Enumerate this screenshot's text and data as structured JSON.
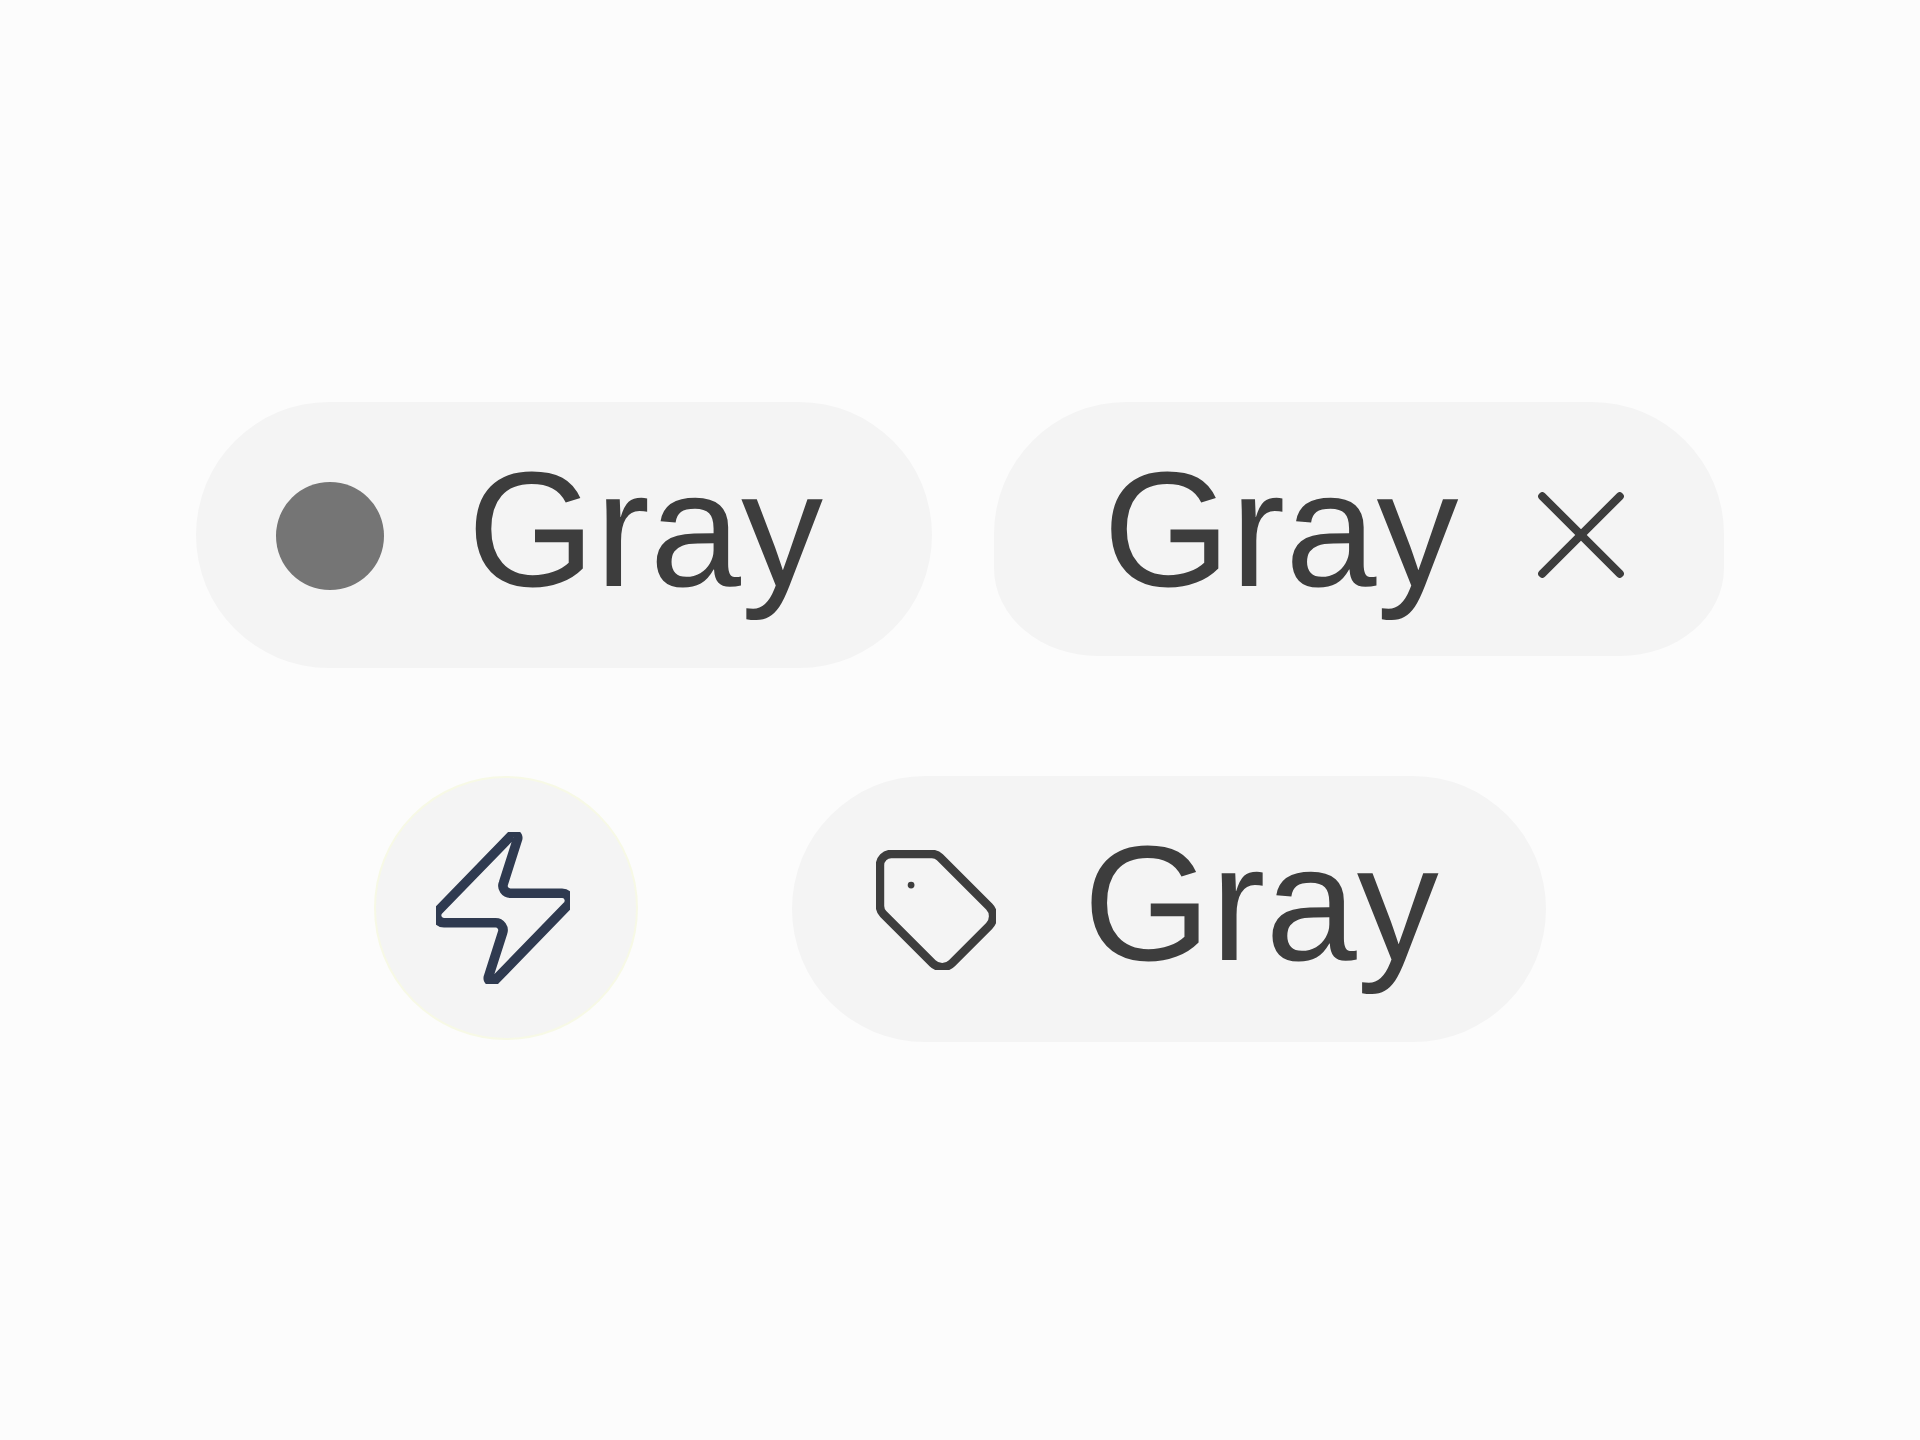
{
  "rows": [
    {
      "chips": [
        {
          "kind": "dot",
          "label": "Gray",
          "color": "#757575"
        },
        {
          "kind": "removable",
          "label": "Gray"
        }
      ]
    },
    {
      "chips": [
        {
          "kind": "icon-only"
        },
        {
          "kind": "icon",
          "label": "Gray"
        }
      ]
    }
  ]
}
